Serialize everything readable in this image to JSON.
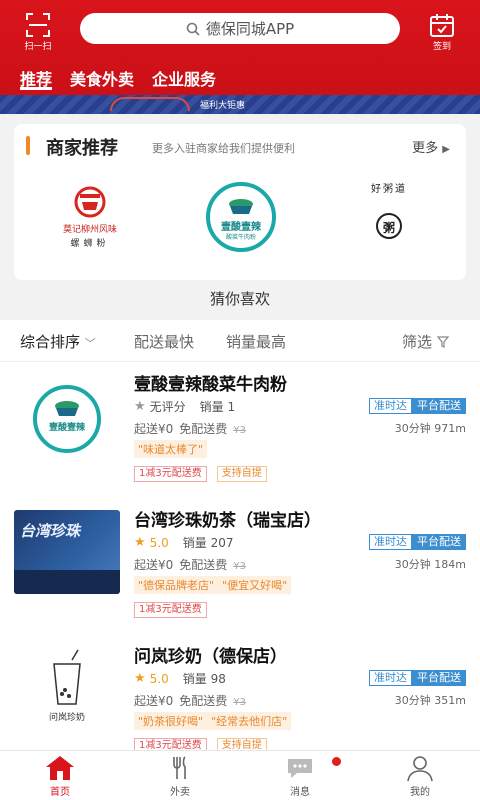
{
  "header": {
    "scan_label": "扫一扫",
    "search_placeholder": "德保同城APP",
    "sign_label": "签到",
    "banner_text": "福利大钜惠",
    "tabs": [
      {
        "label": "推荐",
        "active": true
      },
      {
        "label": "美食外卖",
        "active": false
      },
      {
        "label": "企业服务",
        "active": false
      }
    ]
  },
  "merchants": {
    "title": "商家推荐",
    "subtitle": "更多入驻商家给我们提供便利",
    "more": "更多",
    "logos": [
      {
        "name": "莫记柳州风味",
        "sub": "螺蛳粉"
      },
      {
        "name": "壹酸壹辣",
        "sub": "酸菜牛肉粉"
      },
      {
        "name": "好粥道",
        "sub": "粥"
      }
    ]
  },
  "guess_title": "猜你喜欢",
  "sortbar": {
    "items": [
      "综合排序",
      "配送最快",
      "销量最高"
    ],
    "filter": "筛选"
  },
  "shops": [
    {
      "name": "壹酸壹辣酸菜牛肉粉",
      "score": "无评分",
      "rated": false,
      "sales": "销量 1",
      "min_order": "起送¥0",
      "delivery": "免配送费",
      "original_fee": "¥3",
      "badge_ontime": "准时达",
      "badge_platform": "平台配送",
      "time_distance": "30分钟 971m",
      "quotes": [
        "\"味道太棒了\""
      ],
      "tags": [
        {
          "text": "1减3元配送费",
          "kind": "red"
        },
        {
          "text": "支持自提",
          "kind": "orange"
        }
      ]
    },
    {
      "name": "台湾珍珠奶茶（瑞宝店）",
      "score": "5.0",
      "rated": true,
      "sales": "销量 207",
      "min_order": "起送¥0",
      "delivery": "免配送费",
      "original_fee": "¥3",
      "badge_ontime": "准时达",
      "badge_platform": "平台配送",
      "time_distance": "30分钟 184m",
      "quotes": [
        "\"德保品牌老店\"",
        "\"便宜又好喝\""
      ],
      "tags": [
        {
          "text": "1减3元配送费",
          "kind": "red"
        }
      ]
    },
    {
      "name": "问岚珍奶（德保店）",
      "score": "5.0",
      "rated": true,
      "sales": "销量 98",
      "min_order": "起送¥0",
      "delivery": "免配送费",
      "original_fee": "¥3",
      "badge_ontime": "准时达",
      "badge_platform": "平台配送",
      "time_distance": "30分钟 351m",
      "quotes": [
        "\"奶茶很好喝\"",
        "\"经常去他们店\""
      ],
      "tags": [
        {
          "text": "1减3元配送费",
          "kind": "red"
        },
        {
          "text": "支持自提",
          "kind": "orange"
        }
      ]
    }
  ],
  "thumb_text": {
    "shop2": "台湾珍珠",
    "shop3": "问岚珍奶"
  },
  "nav": [
    {
      "label": "首页",
      "icon": "home-icon",
      "active": true
    },
    {
      "label": "外卖",
      "icon": "cutlery-icon",
      "active": false
    },
    {
      "label": "消息",
      "icon": "message-icon",
      "active": false
    },
    {
      "label": "我的",
      "icon": "user-icon",
      "active": false
    }
  ],
  "colors": {
    "brand_red": "#d9141b",
    "accent_blue": "#3b8ed0",
    "accent_orange": "#e8882c"
  }
}
